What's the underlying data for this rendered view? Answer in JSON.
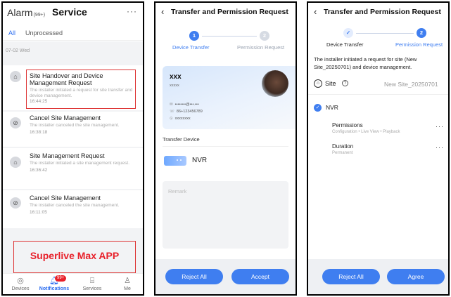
{
  "colors": {
    "accent": "#3f7ef0",
    "highlight_border": "#d33",
    "app_label": "#e8202a",
    "inactive_step": "#d6dbe3"
  },
  "phone1": {
    "header": {
      "title": "Alarm",
      "count": "(99+)",
      "service": "Service",
      "more": "···"
    },
    "tabs": {
      "all": "All",
      "unprocessed": "Unprocessed"
    },
    "date": "07-02 Wed",
    "items": [
      {
        "title": "Site Handover and Device Management Request",
        "desc": "The installer initiated a request for site transfer and device management.",
        "time": "16:44:25",
        "icon": "site-icon"
      },
      {
        "title": "Cancel Site Management",
        "desc": "The installer canceled the site management.",
        "time": "16:38:18",
        "icon": "cancel-icon"
      },
      {
        "title": "Site Management Request",
        "desc": "The installer initiated a site management request.",
        "time": "16:36:42",
        "icon": "site-icon"
      },
      {
        "title": "Cancel Site Management",
        "desc": "The installer canceled the site management.",
        "time": "16:11:05",
        "icon": "cancel-icon"
      }
    ],
    "app_label": "Superlive Max APP",
    "nav": {
      "devices": "Devices",
      "notifications": "Notifications",
      "notifications_badge": "99+",
      "services": "Services",
      "me": "Me"
    }
  },
  "phone2": {
    "title": "Transfer and Permission Request",
    "back": "‹",
    "steps": [
      {
        "num": "1",
        "label": "Device Transfer"
      },
      {
        "num": "2",
        "label": "Permission Request"
      }
    ],
    "installer": {
      "name": "xxx",
      "company": "xxxxx",
      "email": "••••••••@•••.•••",
      "phone": "86+123456789",
      "address": "xxxxxxxx"
    },
    "transfer_device_label": "Transfer Device",
    "device_name": "NVR",
    "remark_placeholder": "Remark",
    "buttons": {
      "reject": "Reject All",
      "accept": "Accept"
    }
  },
  "phone3": {
    "title": "Transfer and Permission Request",
    "back": "‹",
    "steps": [
      {
        "num": "✓",
        "label": "Device Transfer"
      },
      {
        "num": "2",
        "label": "Permission Request"
      }
    ],
    "intro": "The installer initiated a request for site (New Site_20250701) and device management.",
    "site_label": "Site",
    "site_help": "?",
    "site_value": "New Site_20250701",
    "device": "NVR",
    "permissions": {
      "title": "Permissions",
      "value": "Configuration • Live View • Playback",
      "more": "···"
    },
    "duration": {
      "title": "Duration",
      "value": "Permanent",
      "more": "···"
    },
    "buttons": {
      "reject": "Reject All",
      "agree": "Agree"
    }
  }
}
